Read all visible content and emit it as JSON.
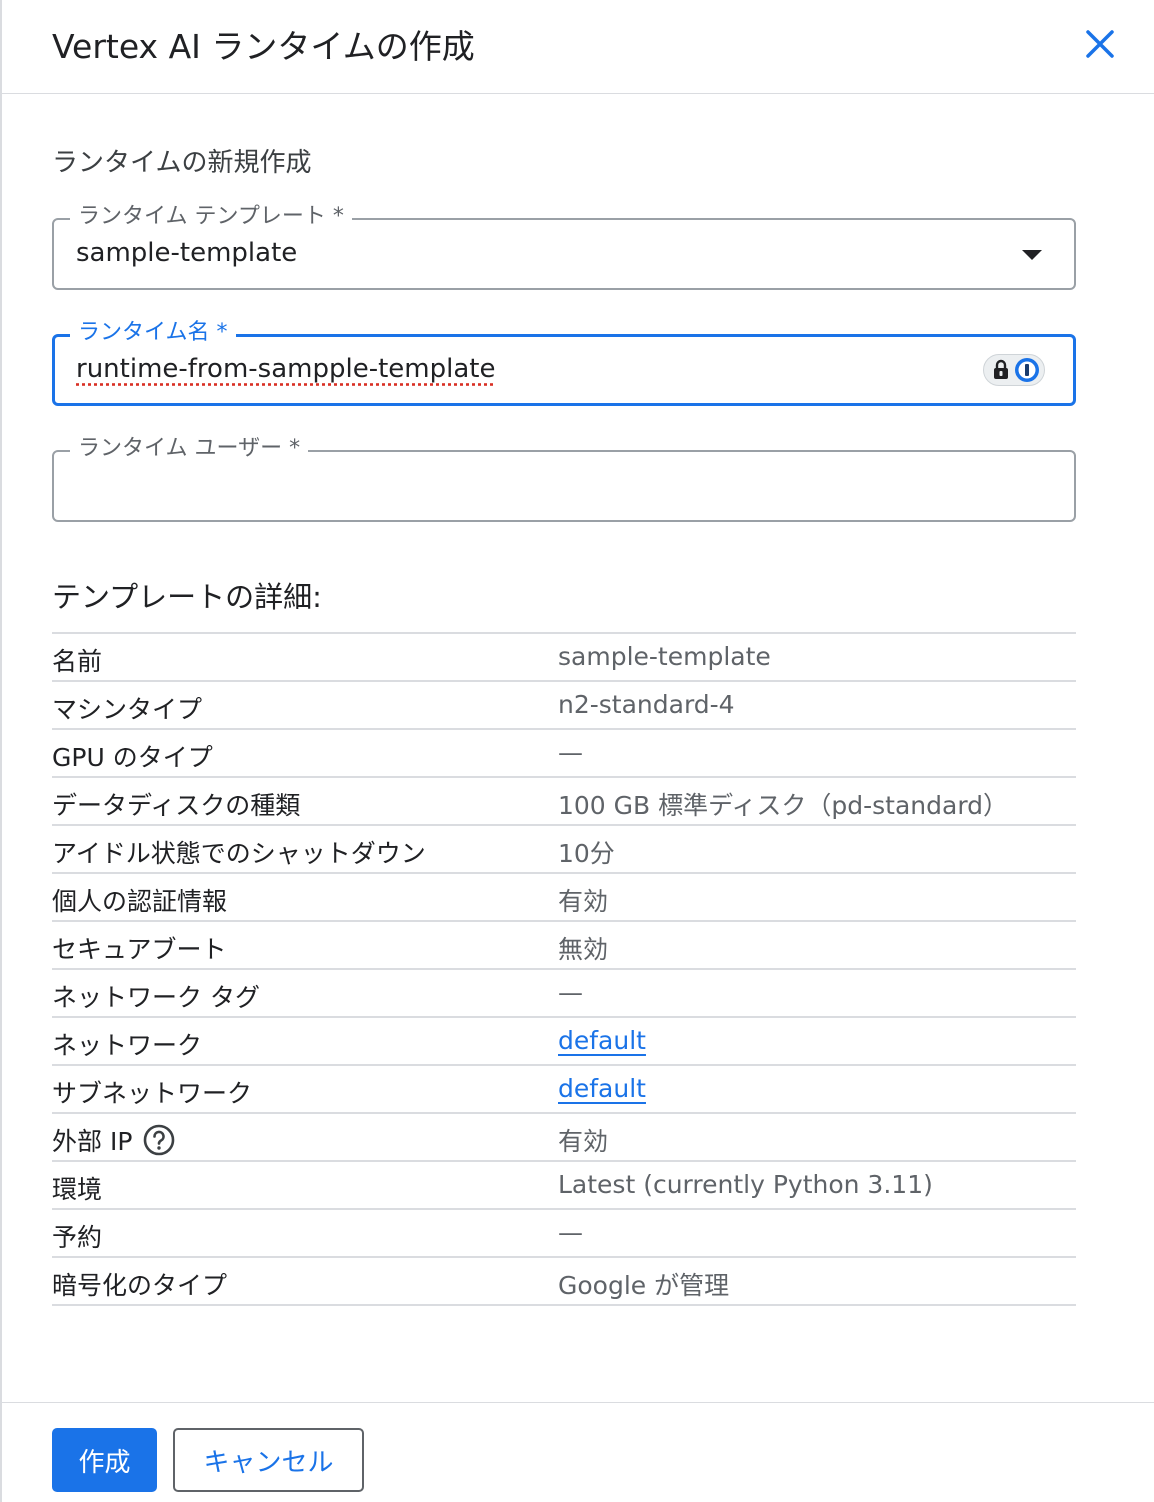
{
  "dialog": {
    "title": "Vertex AI ランタイムの作成",
    "subtitle": "ランタイムの新規作成"
  },
  "form": {
    "template": {
      "label": "ランタイム テンプレート *",
      "value": "sample-template"
    },
    "runtime_name": {
      "label": "ランタイム名 *",
      "value": "runtime-from-sampple-template"
    },
    "runtime_user": {
      "label": "ランタイム ユーザー *",
      "value": ""
    }
  },
  "details": {
    "title": "テンプレートの詳細:",
    "rows": [
      {
        "key": "名前",
        "value": "sample-template"
      },
      {
        "key": "マシンタイプ",
        "value": "n2-standard-4"
      },
      {
        "key": "GPU のタイプ",
        "value": "—"
      },
      {
        "key": "データディスクの種類",
        "value": "100 GB 標準ディスク（pd-standard）"
      },
      {
        "key": "アイドル状態でのシャットダウン",
        "value": "10分"
      },
      {
        "key": "個人の認証情報",
        "value": "有効"
      },
      {
        "key": "セキュアブート",
        "value": "無効"
      },
      {
        "key": "ネットワーク タグ",
        "value": "—"
      },
      {
        "key": "ネットワーク",
        "value": "default"
      },
      {
        "key": "サブネットワーク",
        "value": "default"
      },
      {
        "key": "外部 IP",
        "value": "有効"
      },
      {
        "key": "環境",
        "value": "Latest (currently Python 3.11)"
      },
      {
        "key": "予約",
        "value": "—"
      },
      {
        "key": "暗号化のタイプ",
        "value": "Google が管理"
      }
    ]
  },
  "footer": {
    "create_label": "作成",
    "cancel_label": "キャンセル"
  },
  "colors": {
    "accent": "#1a73e8",
    "border": "#dadce0"
  }
}
